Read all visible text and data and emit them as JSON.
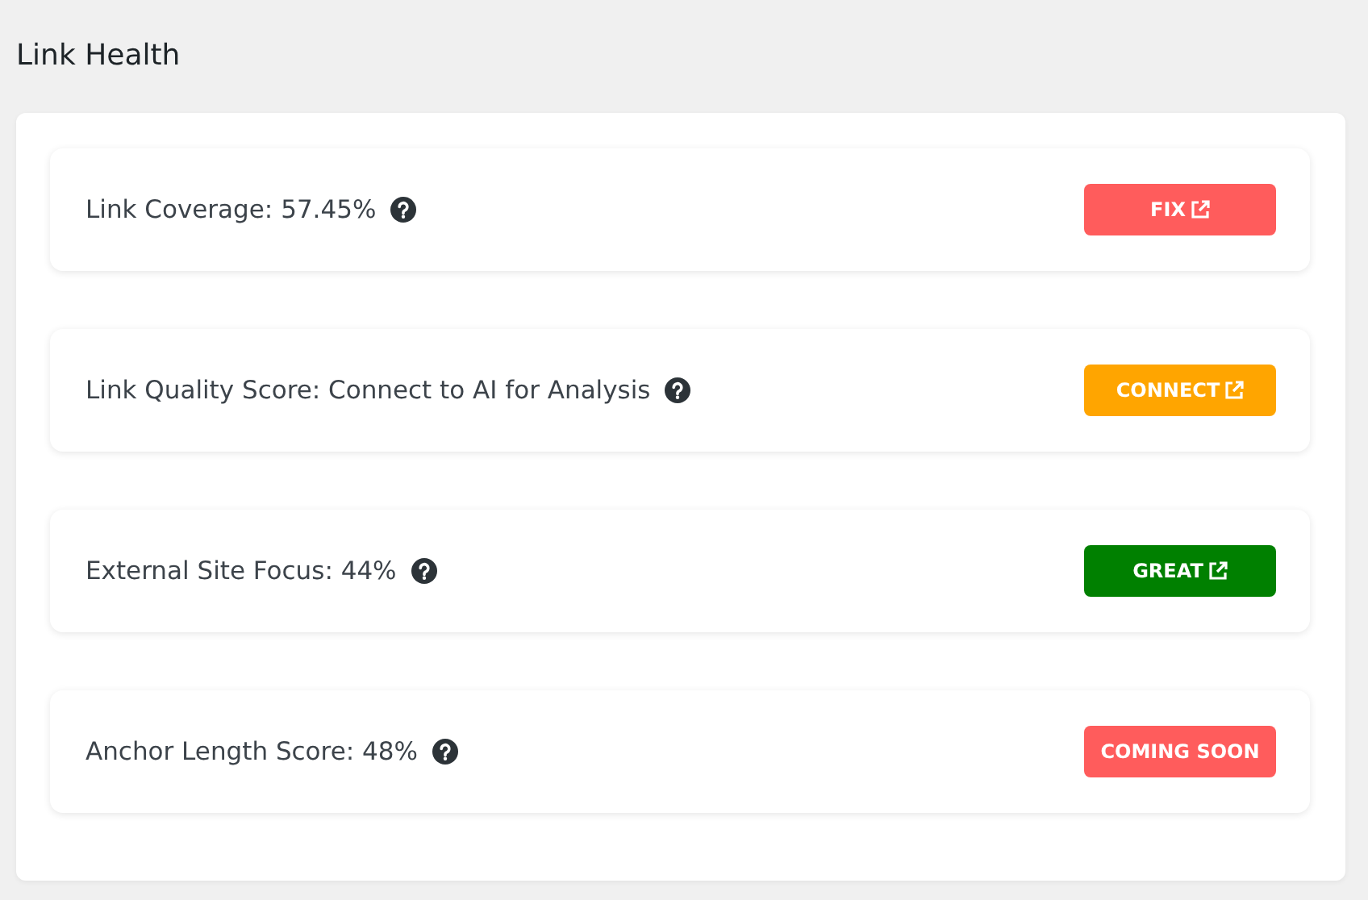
{
  "title": "Link Health",
  "metrics": [
    {
      "label": "Link Coverage: 57.45%",
      "button": {
        "label": "FIX",
        "color": "#ff5c5c",
        "external": true
      }
    },
    {
      "label": "Link Quality Score: Connect to AI for Analysis",
      "button": {
        "label": "CONNECT",
        "color": "#ffa500",
        "external": true
      }
    },
    {
      "label": "External Site Focus: 44%",
      "button": {
        "label": "GREAT",
        "color": "#008000",
        "external": true
      }
    },
    {
      "label": "Anchor Length Score: 48%",
      "button": {
        "label": "COMING SOON",
        "color": "#ff5c5c",
        "external": false
      }
    }
  ]
}
